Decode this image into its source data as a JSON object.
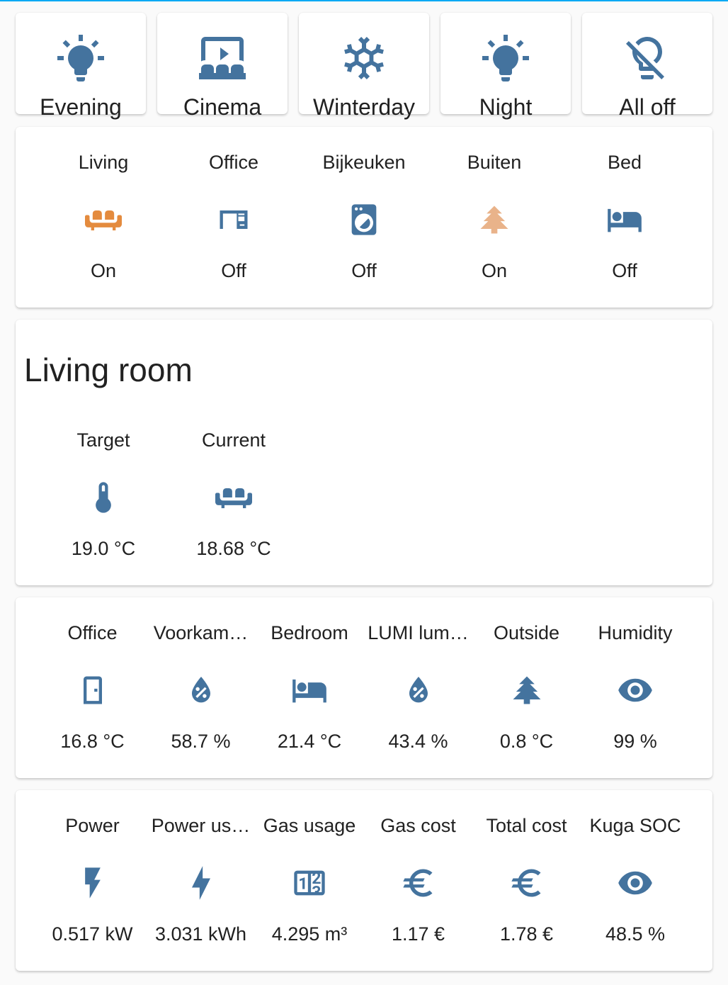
{
  "colors": {
    "icon_blue": "#44739e",
    "active_orange": "#e48b3e",
    "active_tree": "#e9b38a",
    "accent_bar": "#03a9f4"
  },
  "scenes": [
    {
      "label": "Evening",
      "icon": "lightbulb-icon"
    },
    {
      "label": "Cinema",
      "icon": "theater-icon"
    },
    {
      "label": "Winterday",
      "icon": "snowflake-icon"
    },
    {
      "label": "Night",
      "icon": "lightbulb-icon"
    },
    {
      "label": "All off",
      "icon": "lightbulb-off-icon"
    }
  ],
  "lights": [
    {
      "name": "Living",
      "state": "On",
      "icon": "sofa-icon"
    },
    {
      "name": "Office",
      "state": "Off",
      "icon": "desk-icon"
    },
    {
      "name": "Bijkeuken",
      "state": "Off",
      "icon": "washing-machine-icon"
    },
    {
      "name": "Buiten",
      "state": "On",
      "icon": "pine-tree-icon"
    },
    {
      "name": "Bed",
      "state": "Off",
      "icon": "bed-icon"
    }
  ],
  "living_room": {
    "title": "Living room",
    "entities": [
      {
        "name": "Target",
        "state": "19.0 °C",
        "icon": "thermometer-icon"
      },
      {
        "name": "Current",
        "state": "18.68 °C",
        "icon": "sofa-icon"
      }
    ]
  },
  "sensors": [
    {
      "name": "Office",
      "state": "16.8 °C",
      "icon": "door-icon"
    },
    {
      "name": "Voorkam…",
      "state": "58.7 %",
      "icon": "water-percent-icon"
    },
    {
      "name": "Bedroom",
      "state": "21.4 °C",
      "icon": "bed-icon"
    },
    {
      "name": "LUMI lum…",
      "state": "43.4 %",
      "icon": "water-percent-icon"
    },
    {
      "name": "Outside",
      "state": "0.8 °C",
      "icon": "pine-tree-icon"
    },
    {
      "name": "Humidity",
      "state": "99 %",
      "icon": "eye-icon"
    }
  ],
  "energy": [
    {
      "name": "Power",
      "state": "0.517 kW",
      "icon": "flash-icon"
    },
    {
      "name": "Power us…",
      "state": "3.031 kWh",
      "icon": "flash-icon"
    },
    {
      "name": "Gas usage",
      "state": "4.295 m³",
      "icon": "counter-icon"
    },
    {
      "name": "Gas cost",
      "state": "1.17 €",
      "icon": "euro-icon"
    },
    {
      "name": "Total cost",
      "state": "1.78 €",
      "icon": "euro-icon"
    },
    {
      "name": "Kuga SOC",
      "state": "48.5 %",
      "icon": "eye-icon"
    }
  ]
}
